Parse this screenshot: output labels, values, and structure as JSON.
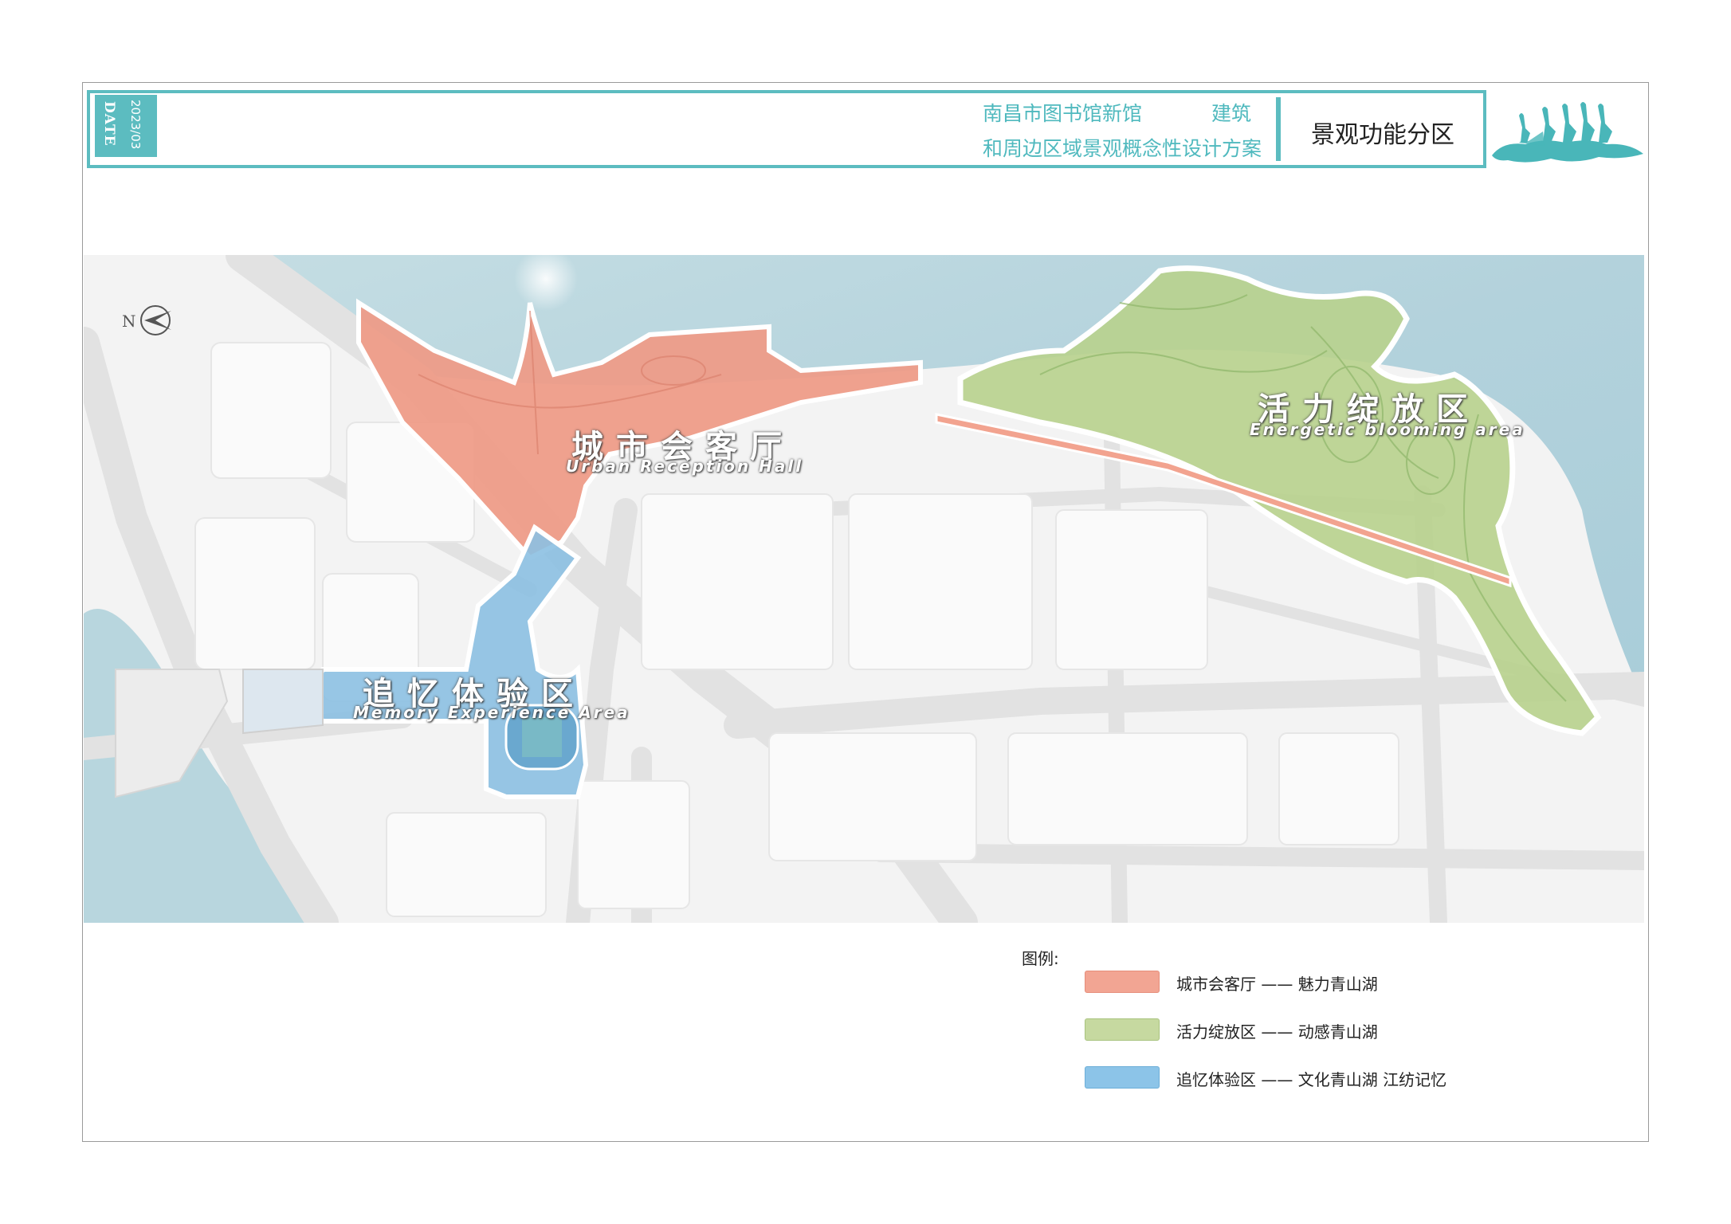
{
  "header": {
    "date_label": "DATE",
    "date_value": "2023/03",
    "project_line1": "南昌市图书馆新馆",
    "project_category": "建筑",
    "project_line2": "和周边区域景观概念性设计方案",
    "page_title": "景观功能分区"
  },
  "map": {
    "compass_label": "N",
    "colors": {
      "water": "#b9d6de",
      "land": "#f2f2f2",
      "road": "#e3e3e3",
      "urban_zone": "#ef9a86",
      "energetic_zone": "#b8d18d",
      "memory_zone": "#8cc0e2"
    },
    "zones": [
      {
        "id": "urban",
        "title": "城市会客厅",
        "subtitle": "Urban Reception Hall"
      },
      {
        "id": "energetic",
        "title": "活力绽放区",
        "subtitle": "Energetic blooming area"
      },
      {
        "id": "memory",
        "title": "追忆体验区",
        "subtitle": "Memory Experience Area"
      }
    ]
  },
  "legend": {
    "title": "图例:",
    "items": [
      {
        "label": "城市会客厅 —— 魅力青山湖",
        "color": "#f2a593"
      },
      {
        "label": "活力绽放区 —— 动感青山湖",
        "color": "#c6d9a0"
      },
      {
        "label": "追忆体验区 —— 文化青山湖  江纺记忆",
        "color": "#8cc4e8"
      }
    ]
  }
}
